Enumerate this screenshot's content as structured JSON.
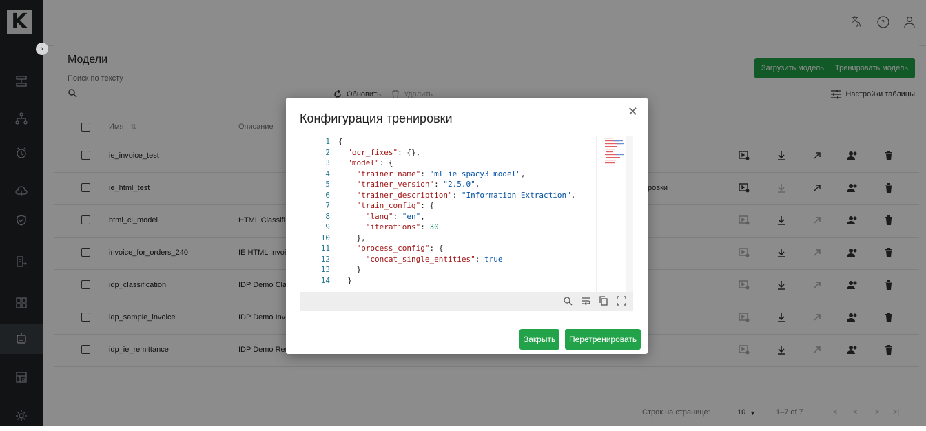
{
  "app": {
    "logo": "K"
  },
  "sidebar": {
    "items": [
      {
        "icon": "flow-icon"
      },
      {
        "icon": "hierarchy-icon"
      },
      {
        "icon": "alarm-icon"
      },
      {
        "icon": "cloud-icon"
      },
      {
        "icon": "shield-check-icon"
      },
      {
        "icon": "document-arrow-icon"
      },
      {
        "icon": "blocks-icon"
      },
      {
        "icon": "robot-icon"
      },
      {
        "icon": "grid-calendar-icon"
      },
      {
        "icon": "gear-icon"
      }
    ]
  },
  "page": {
    "title": "Модели",
    "search_label": "Поиск по тексту",
    "refresh_label": "Обновить",
    "delete_label": "Удалить",
    "upload_label": "Загрузить модель",
    "train_label": "Тренировать модель",
    "settings_label": "Настройки таблицы"
  },
  "table": {
    "columns": {
      "name": "Имя",
      "description": "Описание"
    },
    "rows": [
      {
        "name": "ie_invoice_test",
        "description": "",
        "extra": ""
      },
      {
        "name": "ie_html_test",
        "description": "",
        "extra": "ровки"
      },
      {
        "name": "html_cl_model",
        "description": "HTML Classifi",
        "extra": ""
      },
      {
        "name": "invoice_for_orders_240",
        "description": "IE HTML Invoi",
        "extra": ""
      },
      {
        "name": "idp_classification",
        "description": "IDP Demo Clas",
        "extra": ""
      },
      {
        "name": "idp_sample_invoice",
        "description": "IDP Demo Invo",
        "extra": ""
      },
      {
        "name": "idp_ie_remittance",
        "description": "IDP Demo Ren",
        "extra": ""
      }
    ]
  },
  "footer": {
    "rows_per_page_label": "Строк на странице:",
    "rows_per_page_value": "10",
    "range": "1–7 of 7"
  },
  "modal": {
    "title": "Конфигурация тренировки",
    "close_label": "Закрыть",
    "retrain_label": "Перетренировать",
    "line_numbers": [
      "1",
      "2",
      "3",
      "4",
      "5",
      "6",
      "7",
      "8",
      "9",
      "10",
      "11",
      "12",
      "13",
      "14"
    ],
    "code_lines": [
      "{",
      "  \"ocr_fixes\": {},",
      "  \"model\": {",
      "    \"trainer_name\": \"ml_ie_spacy3_model\",",
      "    \"trainer_version\": \"2.5.0\",",
      "    \"trainer_description\": \"Information Extraction\",",
      "    \"train_config\": {",
      "      \"lang\": \"en\",",
      "      \"iterations\": 30",
      "    },",
      "    \"process_config\": {",
      "      \"concat_single_entities\": true",
      "    }",
      "  }"
    ]
  }
}
